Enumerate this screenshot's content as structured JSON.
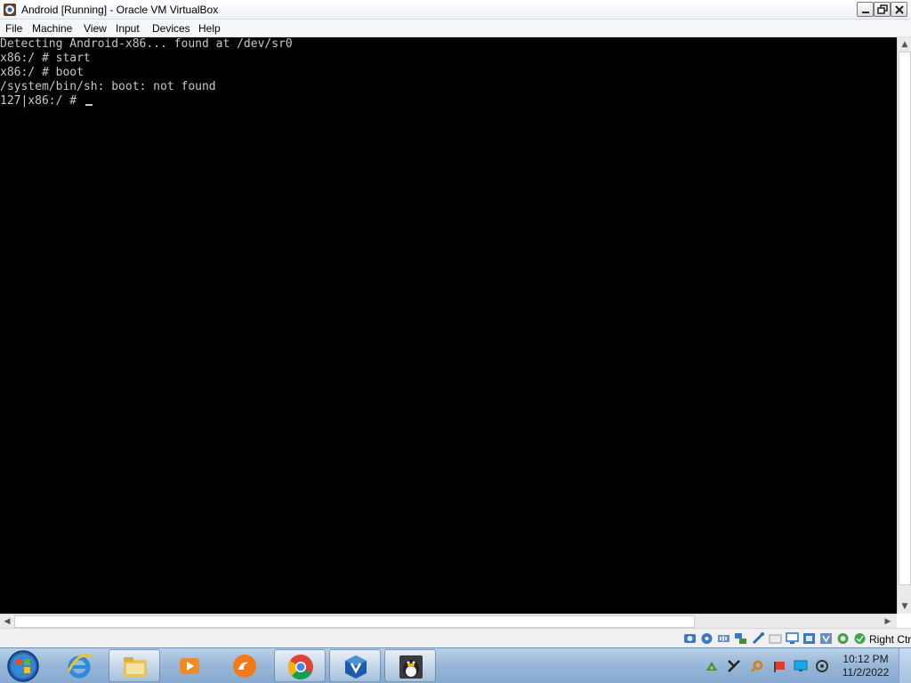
{
  "window": {
    "title": "Android [Running] - Oracle VM VirtualBox"
  },
  "menu": {
    "items": [
      {
        "label": "File"
      },
      {
        "label": "Machine"
      },
      {
        "label": "View"
      },
      {
        "label": "Input"
      },
      {
        "label": "Devices"
      },
      {
        "label": "Help"
      }
    ]
  },
  "console": {
    "lines": [
      "Detecting Android-x86... found at /dev/sr0",
      "x86:/ # start",
      "x86:/ # boot",
      "/system/bin/sh: boot: not found",
      "127|x86:/ # "
    ]
  },
  "statusbar": {
    "host_key": "Right Ctrl",
    "icons": [
      "hard-disk-icon",
      "optical-drive-icon",
      "audio-icon",
      "network-icon",
      "usb-icon",
      "shared-folders-icon",
      "display-icon",
      "video-capture-icon",
      "virtualization-icon",
      "mouse-integration-icon",
      "keyboard-capture-icon"
    ]
  },
  "taskbar": {
    "apps": [
      "internet-explorer-icon",
      "file-explorer-icon",
      "media-player-icon",
      "uc-browser-icon",
      "chrome-icon",
      "virtualbox-icon",
      "android-vm-icon"
    ],
    "tray_icons": [
      "network-tray-icon",
      "tools-tray-icon",
      "search-tray-icon",
      "flag-tray-icon",
      "monitor-tray-icon",
      "volume-tray-icon"
    ]
  },
  "clock": {
    "time": "10:12 PM",
    "date": "11/2/2022"
  },
  "colors": {
    "console_bg": "#000000",
    "console_fg": "#c8c8c8",
    "taskbar": "#9ab8d8"
  }
}
